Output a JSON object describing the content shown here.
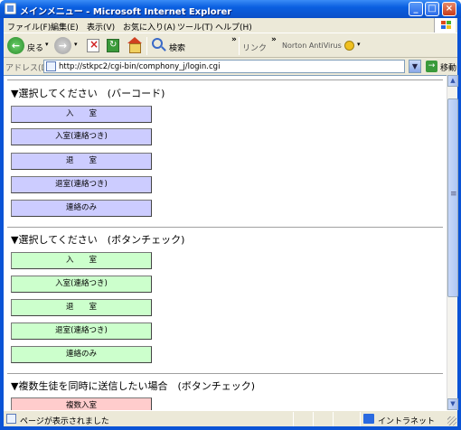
{
  "window": {
    "title": "メインメニュー - Microsoft Internet Explorer"
  },
  "menu": [
    "ファイル(F)",
    "編集(E)",
    "表示(V)",
    "お気に入り(A)",
    "ツール(T)",
    "ヘルプ(H)"
  ],
  "toolbar": {
    "back_label": "戻る",
    "search_label": "検索",
    "links_label": "リンク",
    "norton_label": "Norton AntiVirus"
  },
  "address": {
    "label": "アドレス(D)",
    "url": "http://stkpc2/cgi-bin/comphony_j/login.cgi",
    "go_label": "移動"
  },
  "content": {
    "section1": {
      "heading": "▼選択してください　(バーコード)",
      "buttons": [
        "入　　室",
        "入室(連絡つき)",
        "退　　室",
        "退室(連絡つき)",
        "連絡のみ"
      ]
    },
    "section2": {
      "heading": "▼選択してください　(ボタンチェック)",
      "buttons": [
        "入　　室",
        "入室(連絡つき)",
        "退　　室",
        "退室(連絡つき)",
        "連絡のみ"
      ]
    },
    "section3": {
      "heading": "▼複数生徒を同時に送信したい場合　(ボタンチェック)",
      "buttons": [
        "複数入室"
      ]
    }
  },
  "status": {
    "text": "ページが表示されました",
    "zone": "イントラネット"
  },
  "colors": {
    "barcode_button": "#ccccff",
    "check_button": "#ccffcc",
    "multi_button": "#ffcccc"
  }
}
